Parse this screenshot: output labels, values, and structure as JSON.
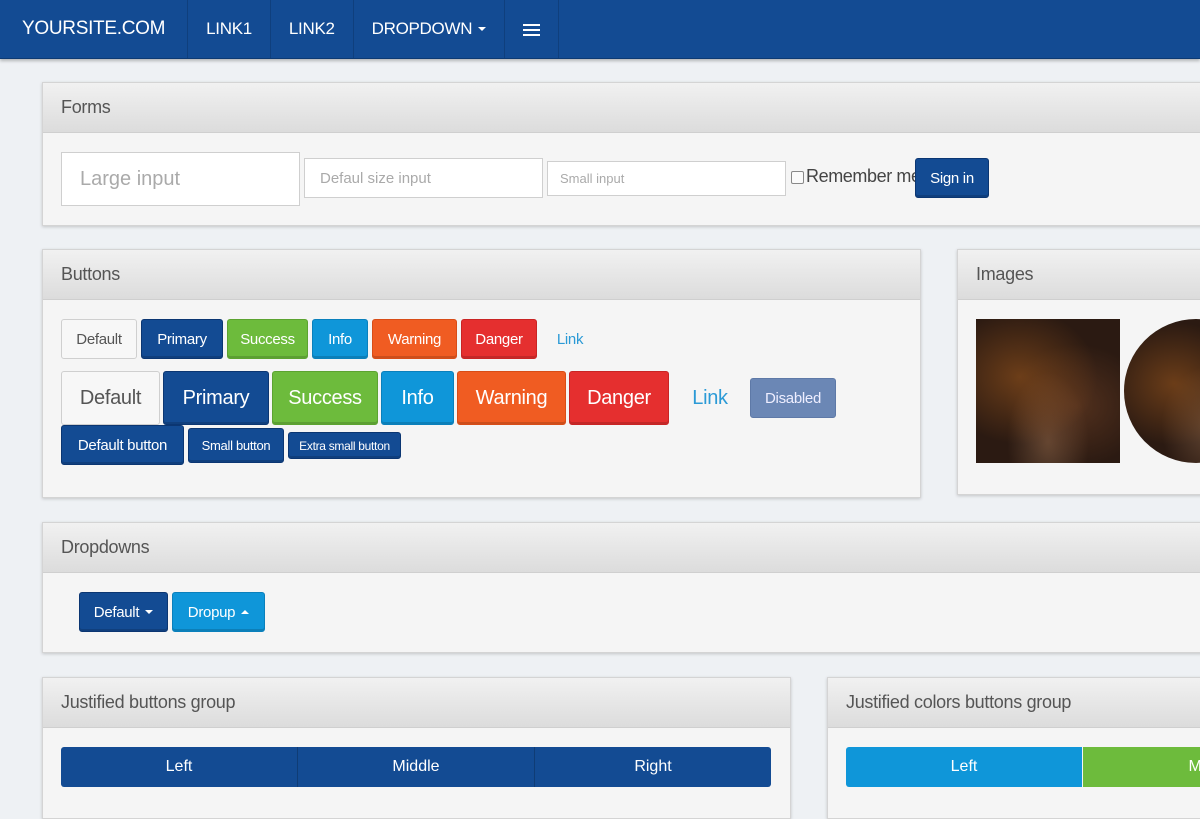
{
  "navbar": {
    "brand": "YOURSITE.COM",
    "links": [
      "LINK1",
      "LINK2"
    ],
    "dropdown": "DROPDOWN",
    "menu_icon": "hamburger-icon"
  },
  "forms": {
    "heading": "Forms",
    "large_placeholder": "Large input",
    "default_placeholder": "Defaul size input",
    "small_placeholder": "Small input",
    "remember_label": "Remember me",
    "sign_in": "Sign in"
  },
  "buttons": {
    "heading": "Buttons",
    "row1": [
      "Default",
      "Primary",
      "Success",
      "Info",
      "Warning",
      "Danger",
      "Link"
    ],
    "row2": [
      "Default",
      "Primary",
      "Success",
      "Info",
      "Warning",
      "Danger",
      "Link",
      "Disabled"
    ],
    "row3": [
      "Default button",
      "Small button",
      "Extra small button"
    ]
  },
  "images": {
    "heading": "Images"
  },
  "dropdowns": {
    "heading": "Dropdowns",
    "default": "Default",
    "dropup": "Dropup"
  },
  "justified": {
    "heading": "Justified buttons group",
    "items": [
      "Left",
      "Middle",
      "Right"
    ]
  },
  "justified_colors": {
    "heading": "Justified colors buttons group",
    "items": [
      "Left",
      "Mic"
    ]
  },
  "colors": {
    "navbar": "#134b93",
    "primary": "#134b93",
    "success": "#6dbb3c",
    "info": "#0f96d9",
    "warning": "#f05c22",
    "danger": "#e52f2f",
    "link": "#2b9ad6"
  }
}
